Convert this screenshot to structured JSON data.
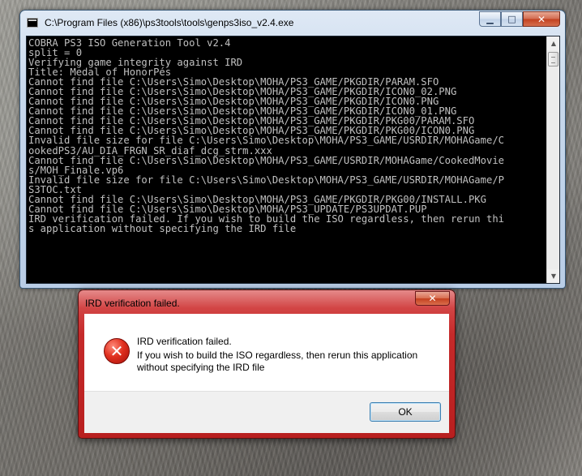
{
  "console": {
    "title": "C:\\Program Files (x86)\\ps3tools\\tools\\genps3iso_v2.4.exe",
    "buttons": {
      "minimize": "▁",
      "maximize": "□",
      "close": "✕"
    },
    "lines": [
      "COBRA PS3 ISO Generation Tool v2.4",
      "split = 0",
      "Verifying game integrity against IRD",
      "Title: Medal of HonorPés",
      "Cannot find file C:\\Users\\Simo\\Desktop\\MOHA/PS3_GAME/PKGDIR/PARAM.SFO",
      "Cannot find file C:\\Users\\Simo\\Desktop\\MOHA/PS3_GAME/PKGDIR/ICON0_02.PNG",
      "Cannot find file C:\\Users\\Simo\\Desktop\\MOHA/PS3_GAME/PKGDIR/ICON0.PNG",
      "Cannot find file C:\\Users\\Simo\\Desktop\\MOHA/PS3_GAME/PKGDIR/ICON0_01.PNG",
      "Cannot find file C:\\Users\\Simo\\Desktop\\MOHA/PS3_GAME/PKGDIR/PKG00/PARAM.SFO",
      "Cannot find file C:\\Users\\Simo\\Desktop\\MOHA/PS3_GAME/PKGDIR/PKG00/ICON0.PNG",
      "Invalid file size for file C:\\Users\\Simo\\Desktop\\MOHA/PS3_GAME/USRDIR/MOHAGame/C",
      "ookedPS3/AU_DIA_FRGN_SR_diaf_dcg_strm.xxx",
      "Cannot find file C:\\Users\\Simo\\Desktop\\MOHA/PS3_GAME/USRDIR/MOHAGame/CookedMovie",
      "s/MOH_Finale.vp6",
      "Invalid file size for file C:\\Users\\Simo\\Desktop\\MOHA/PS3_GAME/USRDIR/MOHAGame/P",
      "S3TOC.txt",
      "Cannot find file C:\\Users\\Simo\\Desktop\\MOHA/PS3_GAME/PKGDIR/PKG00/INSTALL.PKG",
      "Cannot find file C:\\Users\\Simo\\Desktop\\MOHA/PS3_UPDATE/PS3UPDAT.PUP",
      "IRD verification failed. If you wish to build the ISO regardless, then rerun thi",
      "s application without specifying the IRD file"
    ]
  },
  "dialog": {
    "title": "IRD verification failed.",
    "close": "✕",
    "icon": "error-icon",
    "message_line1": "IRD verification failed.",
    "message_line2": "If you wish to build the ISO regardless, then rerun this application",
    "message_line3": "without specifying the IRD file",
    "ok_label": "OK"
  }
}
